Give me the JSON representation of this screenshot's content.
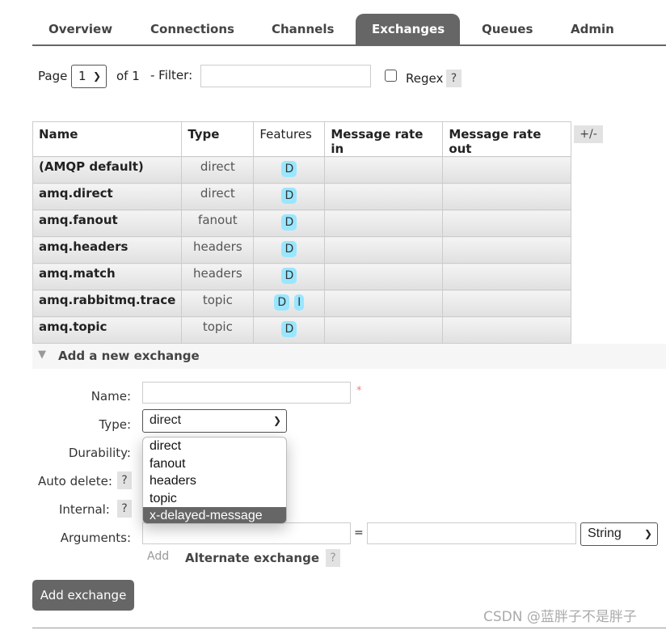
{
  "nav": {
    "tabs": [
      {
        "label": "Overview"
      },
      {
        "label": "Connections"
      },
      {
        "label": "Channels"
      },
      {
        "label": "Exchanges",
        "active": true
      },
      {
        "label": "Queues"
      },
      {
        "label": "Admin"
      }
    ]
  },
  "pager": {
    "page_label": "Page",
    "page_value": "1",
    "of_label": "of 1",
    "filter_label": "- Filter:",
    "filter_value": "",
    "regex_label": "Regex",
    "regex_checked": false,
    "help": "?"
  },
  "table": {
    "headers": [
      "Name",
      "Type",
      "Features",
      "Message rate in",
      "Message rate out"
    ],
    "toggle_columns": "+/-",
    "rows": [
      {
        "name": "(AMQP default)",
        "type": "direct",
        "features": [
          "D"
        ]
      },
      {
        "name": "amq.direct",
        "type": "direct",
        "features": [
          "D"
        ]
      },
      {
        "name": "amq.fanout",
        "type": "fanout",
        "features": [
          "D"
        ]
      },
      {
        "name": "amq.headers",
        "type": "headers",
        "features": [
          "D"
        ]
      },
      {
        "name": "amq.match",
        "type": "headers",
        "features": [
          "D"
        ]
      },
      {
        "name": "amq.rabbitmq.trace",
        "type": "topic",
        "features": [
          "D",
          "I"
        ]
      },
      {
        "name": "amq.topic",
        "type": "topic",
        "features": [
          "D"
        ]
      }
    ]
  },
  "add_exchange": {
    "section_title": "Add a new exchange",
    "name_label": "Name:",
    "name_value": "",
    "required_mark": "*",
    "type_label": "Type:",
    "type_value": "direct",
    "type_options": [
      "direct",
      "fanout",
      "headers",
      "topic",
      "x-delayed-message"
    ],
    "highlighted_option": "x-delayed-message",
    "durability_label": "Durability:",
    "auto_delete_label": "Auto delete:",
    "internal_label": "Internal:",
    "help": "?",
    "arguments_label": "Arguments:",
    "equals": "=",
    "arg_type_value": "String",
    "add_link": "Add",
    "alternate_exchange": "Alternate exchange",
    "submit": "Add exchange"
  },
  "watermark": "CSDN @蓝胖子不是胖子"
}
